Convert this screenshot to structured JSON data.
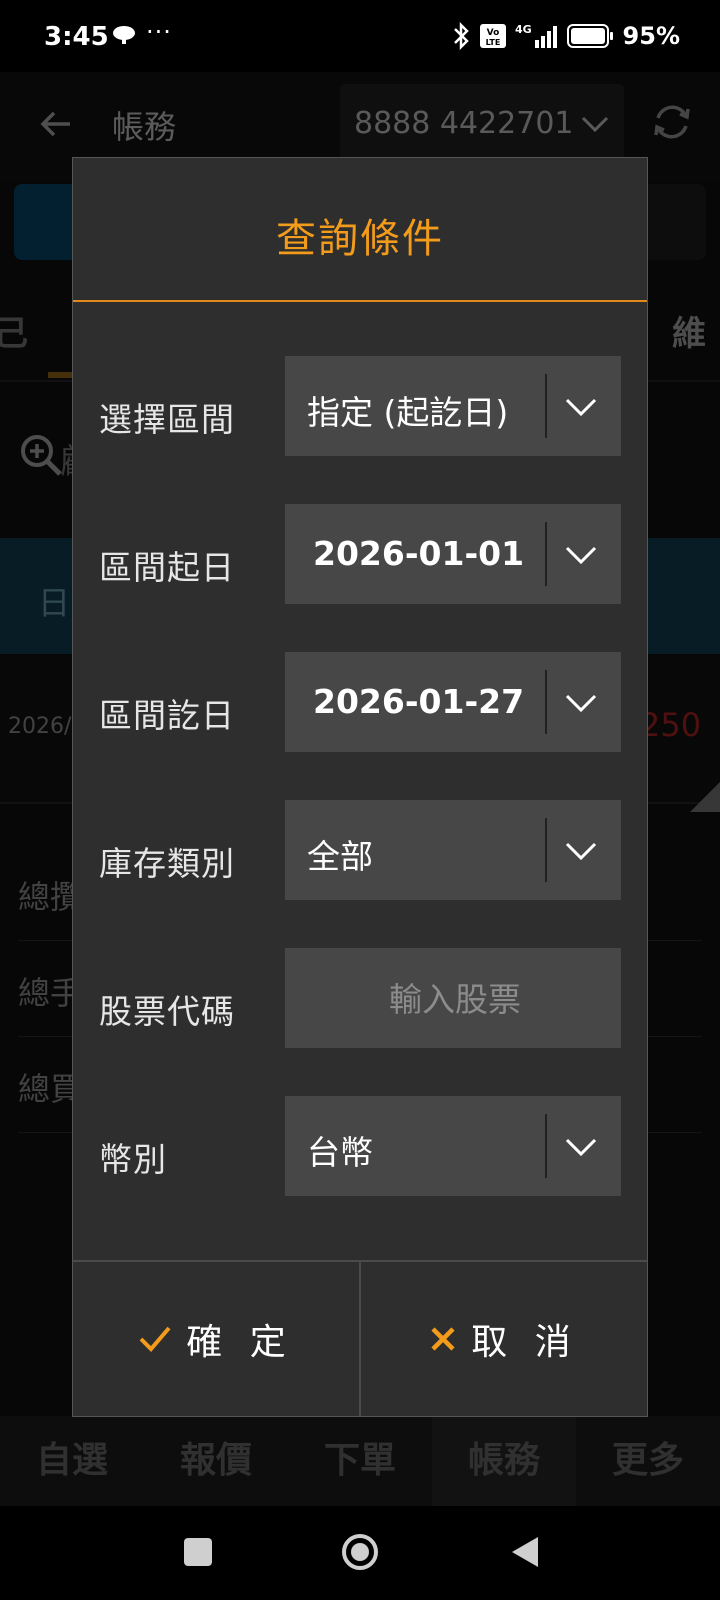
{
  "status_bar": {
    "time": "3:45",
    "more": "···",
    "battery": "95%",
    "volte": "VoLTE",
    "network": "4G"
  },
  "app": {
    "title": "帳務",
    "account": "8888 4422701",
    "tab_left": "己",
    "tab_right": "維",
    "search_hint": "顧",
    "table_header": "日",
    "row_date": "2026/",
    "row_value": "250",
    "summary_labels": [
      "總攬",
      "總手",
      "總買"
    ]
  },
  "bottom_nav": [
    "自選",
    "報價",
    "下單",
    "帳務",
    "更多"
  ],
  "dialog": {
    "title": "查詢條件",
    "fields": [
      {
        "label": "選擇區間",
        "value": "指定 (起訖日)"
      },
      {
        "label": "區間起日",
        "value": "2026-01-01"
      },
      {
        "label": "區間訖日",
        "value": "2026-01-27"
      },
      {
        "label": "庫存類別",
        "value": "全部"
      },
      {
        "label": "股票代碼",
        "placeholder": "輸入股票"
      },
      {
        "label": "幣別",
        "value": "台幣"
      }
    ],
    "confirm_label": "確 定",
    "cancel_label": "取 消"
  },
  "colors": {
    "accent": "#f39c1b",
    "dialog_bg": "#2e2e2e",
    "field_bg": "#474747"
  }
}
